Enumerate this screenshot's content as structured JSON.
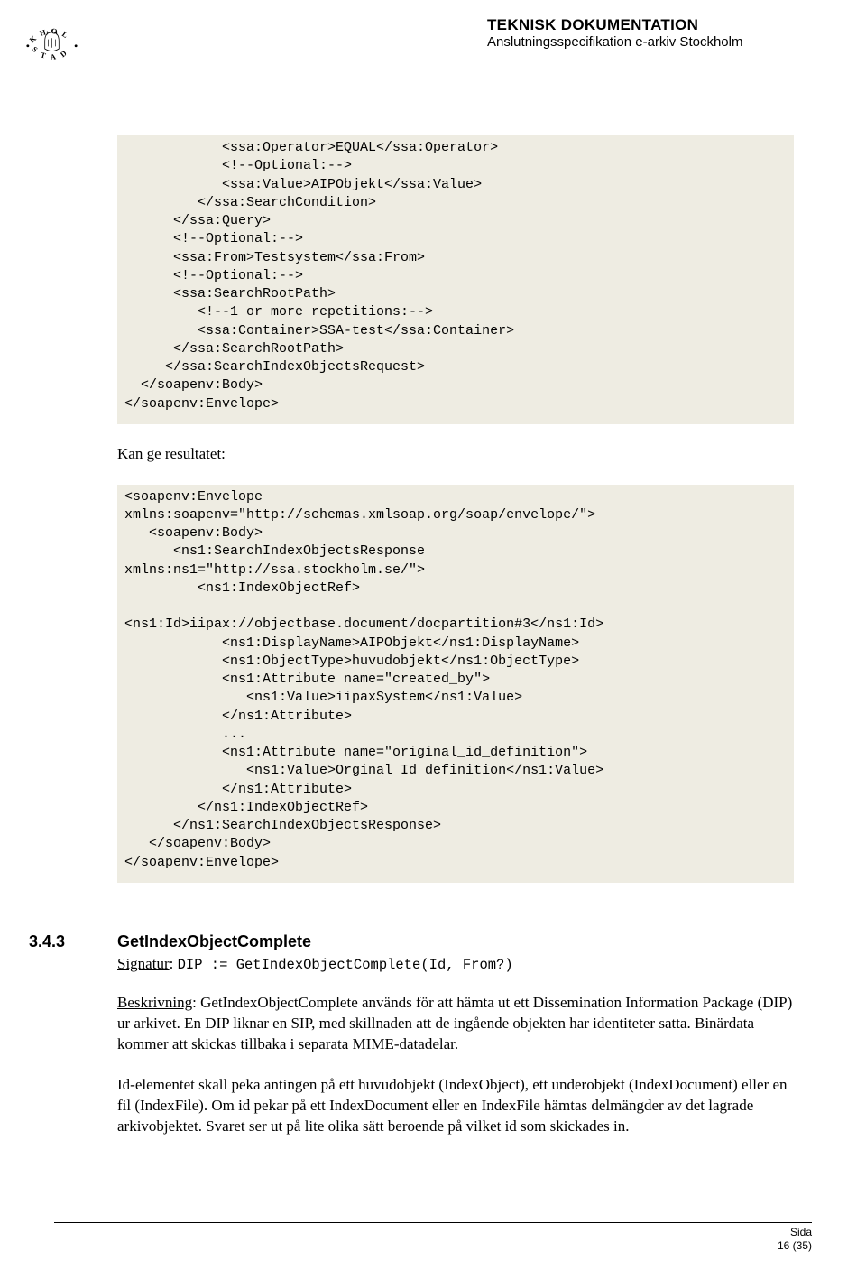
{
  "header": {
    "title": "TEKNISK DOKUMENTATION",
    "subtitle": "Anslutningsspecifikation e-arkiv Stockholm"
  },
  "code1": "            <ssa:Operator>EQUAL</ssa:Operator>\n            <!--Optional:-->\n            <ssa:Value>AIPObjekt</ssa:Value>\n         </ssa:SearchCondition>\n      </ssa:Query>\n      <!--Optional:-->\n      <ssa:From>Testsystem</ssa:From>\n      <!--Optional:-->\n      <ssa:SearchRootPath>\n         <!--1 or more repetitions:-->\n         <ssa:Container>SSA-test</ssa:Container>\n      </ssa:SearchRootPath>\n     </ssa:SearchIndexObjectsRequest>\n  </soapenv:Body>\n</soapenv:Envelope>",
  "result_label": "Kan ge resultatet:",
  "code2": "<soapenv:Envelope\nxmlns:soapenv=\"http://schemas.xmlsoap.org/soap/envelope/\">\n   <soapenv:Body>\n      <ns1:SearchIndexObjectsResponse\nxmlns:ns1=\"http://ssa.stockholm.se/\">\n         <ns1:IndexObjectRef>\n\n<ns1:Id>iipax://objectbase.document/docpartition#3</ns1:Id>\n            <ns1:DisplayName>AIPObjekt</ns1:DisplayName>\n            <ns1:ObjectType>huvudobjekt</ns1:ObjectType>\n            <ns1:Attribute name=\"created_by\">\n               <ns1:Value>iipaxSystem</ns1:Value>\n            </ns1:Attribute>\n            ...\n            <ns1:Attribute name=\"original_id_definition\">\n               <ns1:Value>Orginal Id definition</ns1:Value>\n            </ns1:Attribute>\n         </ns1:IndexObjectRef>\n      </ns1:SearchIndexObjectsResponse>\n   </soapenv:Body>\n</soapenv:Envelope>",
  "section": {
    "num": "3.4.3",
    "title": "GetIndexObjectComplete",
    "sig_label": "Signatur",
    "sig_sep": ": ",
    "sig_code": "DIP := GetIndexObjectComplete(Id, From?)",
    "desc_label": "Beskrivning",
    "desc_text": ": GetIndexObjectComplete används för att hämta ut ett Dissemination Information Package (DIP) ur arkivet. En DIP liknar en SIP, med skillnaden att de ingående objekten har identiteter satta. Binärdata kommer att skickas tillbaka i separata MIME-datadelar.",
    "para2": "Id-elementet skall peka antingen på ett huvudobjekt (IndexObject), ett underobjekt (IndexDocument) eller en fil (IndexFile). Om id pekar på ett IndexDocument eller en IndexFile hämtas delmängder av det lagrade arkivobjektet. Svaret ser ut på lite olika sätt beroende på vilket id som skickades in."
  },
  "footer": {
    "line1": "Sida",
    "line2": "16 (35)"
  }
}
